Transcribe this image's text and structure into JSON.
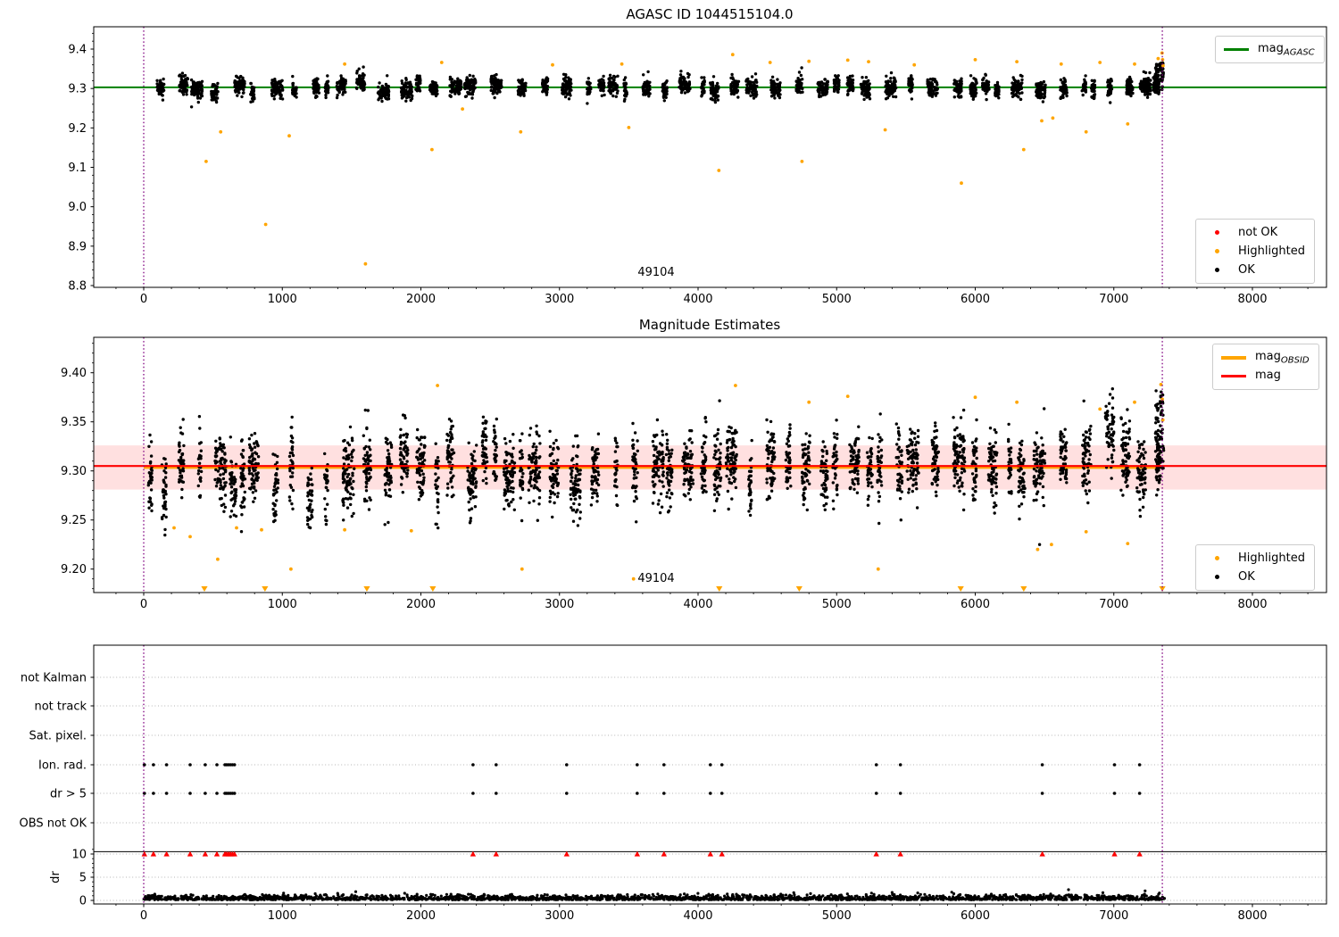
{
  "figure": {
    "background": "#ffffff"
  },
  "colors": {
    "mag_agasc_line": "#008000",
    "mag_line": "#ff0000",
    "mag_obsid_line": "#ffa500",
    "highlighted": "#ffa500",
    "not_ok": "#ff0000",
    "ok": "#000000",
    "obsid_boundary": "#800080",
    "mag_err_band": "rgba(255,0,0,0.12)",
    "grid_dotted": "#b5b5b5"
  },
  "legends": {
    "top_line": {
      "items": [
        {
          "label_main": "mag",
          "label_sub": "AGASC",
          "color": "#008000",
          "type": "line"
        }
      ]
    },
    "top_markers": {
      "items": [
        {
          "label": "not OK",
          "color": "#ff0000"
        },
        {
          "label": "Highlighted",
          "color": "#ffa500"
        },
        {
          "label": "OK",
          "color": "#000000"
        }
      ]
    },
    "mid_lines": {
      "items": [
        {
          "label_main": "mag",
          "label_sub": "OBSID",
          "color": "#ffa500",
          "type": "line-thick"
        },
        {
          "label_main": "mag",
          "label_sub": "",
          "color": "#ff0000",
          "type": "line"
        }
      ]
    },
    "mid_markers": {
      "items": [
        {
          "label": "Highlighted",
          "color": "#ffa500"
        },
        {
          "label": "OK",
          "color": "#000000"
        }
      ]
    }
  },
  "chart_data": [
    {
      "type": "scatter",
      "title": "AGASC ID 1044515104.0",
      "xlim": [
        -361,
        8534
      ],
      "ylim": [
        8.795,
        9.457
      ],
      "xticks": [
        0,
        1000,
        2000,
        3000,
        4000,
        5000,
        6000,
        7000,
        8000
      ],
      "xtick_labels": [
        "0",
        "1000",
        "2000",
        "3000",
        "4000",
        "5000",
        "6000",
        "7000",
        "8000"
      ],
      "yticks": [
        8.8,
        8.9,
        9.0,
        9.1,
        9.2,
        9.3,
        9.4
      ],
      "ytick_labels": [
        "8.8",
        "8.9",
        "9.0",
        "9.1",
        "9.2",
        "9.3",
        "9.4"
      ],
      "mag_agasc": 9.303,
      "obsid_boundaries_x": [
        0,
        7350
      ],
      "annotation": {
        "text": "49104",
        "x": 3697,
        "y": 8.825
      },
      "ok_points_model": {
        "seed": 42,
        "x_start": 15,
        "x_end": 7290,
        "gap_min": 18,
        "gap_rand": 105,
        "w_min": 22,
        "w_rand": 62,
        "density": 0.85,
        "pts_base": 8,
        "cluster_sigma": 0.0068,
        "point_sigma": 0.0115,
        "base_mag": 9.302,
        "trend_x0": 6300,
        "trend_mag": 0.011,
        "tail_prob": 0.06,
        "tail_mag": 0.022,
        "clamp": [
          9.245,
          9.405
        ],
        "final_cluster": {
          "x0": 7300,
          "x1": 7358,
          "n": 70,
          "y0": 9.295,
          "y1": 9.365
        }
      },
      "highlighted_points": [
        [
          450,
          9.115
        ],
        [
          555,
          9.19
        ],
        [
          880,
          8.955
        ],
        [
          1050,
          9.18
        ],
        [
          1600,
          8.855
        ],
        [
          2080,
          9.145
        ],
        [
          2300,
          9.248
        ],
        [
          2720,
          9.19
        ],
        [
          3500,
          9.201
        ],
        [
          4150,
          9.092
        ],
        [
          4750,
          9.115
        ],
        [
          5350,
          9.195
        ],
        [
          5900,
          9.06
        ],
        [
          6350,
          9.145
        ],
        [
          6480,
          9.218
        ],
        [
          6560,
          9.225
        ],
        [
          6800,
          9.19
        ],
        [
          7100,
          9.21
        ],
        [
          1450,
          9.362
        ],
        [
          2150,
          9.366
        ],
        [
          2950,
          9.36
        ],
        [
          3450,
          9.362
        ],
        [
          4250,
          9.386
        ],
        [
          4520,
          9.366
        ],
        [
          4800,
          9.369
        ],
        [
          5080,
          9.372
        ],
        [
          5230,
          9.368
        ],
        [
          5560,
          9.36
        ],
        [
          6000,
          9.373
        ],
        [
          6300,
          9.368
        ],
        [
          6620,
          9.362
        ],
        [
          6900,
          9.366
        ],
        [
          7150,
          9.362
        ],
        [
          7320,
          9.376
        ],
        [
          7348,
          9.39
        ],
        [
          7352,
          9.373
        ],
        [
          7355,
          9.358
        ]
      ],
      "not_ok_points": []
    },
    {
      "type": "scatter",
      "title": "Magnitude Estimates",
      "xlim": [
        -361,
        8534
      ],
      "ylim": [
        9.176,
        9.436
      ],
      "xticks": [
        0,
        1000,
        2000,
        3000,
        4000,
        5000,
        6000,
        7000,
        8000
      ],
      "xtick_labels": [
        "0",
        "1000",
        "2000",
        "3000",
        "4000",
        "5000",
        "6000",
        "7000",
        "8000"
      ],
      "yticks": [
        9.2,
        9.25,
        9.3,
        9.35,
        9.4
      ],
      "ytick_labels": [
        "9.20",
        "9.25",
        "9.30",
        "9.35",
        "9.40"
      ],
      "mag": 9.305,
      "mag_obsid": 9.3035,
      "mag_err_band": [
        9.281,
        9.326
      ],
      "obsid_boundaries_x": [
        0,
        7350
      ],
      "annotation": {
        "text": "49104",
        "x": 3697,
        "y": 9.187
      },
      "ok_points_model": {
        "seed": 7,
        "x_start": 15,
        "x_end": 7290,
        "gap_min": 18,
        "gap_rand": 100,
        "w_min": 22,
        "w_rand": 62,
        "density": 0.9,
        "pts_base": 8,
        "cluster_sigma": 0.0105,
        "point_sigma": 0.0175,
        "base_mag": 9.2955,
        "trend_full": 0.023,
        "tail_prob": 0.09,
        "tail_mag": 0.035,
        "tail_left": true,
        "clamp": [
          9.225,
          9.4
        ],
        "final_cluster": {
          "x0": 7300,
          "x1": 7360,
          "n": 85,
          "y0": 9.3,
          "y1": 9.382
        }
      },
      "highlighted_points": [
        [
          219,
          9.242
        ],
        [
          335,
          9.233
        ],
        [
          534,
          9.21
        ],
        [
          670,
          9.242
        ],
        [
          850,
          9.24
        ],
        [
          1062,
          9.2
        ],
        [
          1450,
          9.24
        ],
        [
          1931,
          9.239
        ],
        [
          2730,
          9.2
        ],
        [
          3534,
          9.19
        ],
        [
          5300,
          9.2
        ],
        [
          6450,
          9.22
        ],
        [
          6550,
          9.225
        ],
        [
          6800,
          9.238
        ],
        [
          7100,
          9.226
        ],
        [
          2120,
          9.387
        ],
        [
          4270,
          9.387
        ],
        [
          4800,
          9.37
        ],
        [
          5080,
          9.376
        ],
        [
          6000,
          9.375
        ],
        [
          6300,
          9.37
        ],
        [
          6900,
          9.363
        ],
        [
          7150,
          9.37
        ],
        [
          7340,
          9.388
        ],
        [
          7350,
          9.373
        ],
        [
          7354,
          9.352
        ]
      ],
      "highlighted_clipped_x": [
        438,
        875,
        1610,
        2086,
        4153,
        4730,
        5895,
        6350,
        7350
      ]
    },
    {
      "type": "scatter",
      "title": "",
      "xlim": [
        -361,
        8534
      ],
      "xticks": [
        0,
        1000,
        2000,
        3000,
        4000,
        5000,
        6000,
        7000,
        8000
      ],
      "xtick_labels": [
        "0",
        "1000",
        "2000",
        "3000",
        "4000",
        "5000",
        "6000",
        "7000",
        "8000"
      ],
      "rows": [
        "not Kalman",
        "not track",
        "Sat. pixel.",
        "Ion. rad.",
        "dr > 5",
        "OBS not OK"
      ],
      "row_flags": {
        "Ion. rad.": [
          5,
          70,
          165,
          335,
          444,
          528,
          586,
          598,
          612,
          626,
          640,
          655,
          2376,
          2543,
          3052,
          3561,
          3754,
          4089,
          4172,
          5286,
          5460,
          6484,
          7005,
          7186
        ],
        "dr > 5": [
          5,
          70,
          165,
          335,
          444,
          528,
          586,
          598,
          612,
          626,
          640,
          655,
          2376,
          2543,
          3052,
          3561,
          3754,
          4089,
          4172,
          5286,
          5460,
          6484,
          7005,
          7186
        ]
      },
      "dr_axis": {
        "label": "dr",
        "ticks": [
          0,
          5,
          10
        ],
        "tick_labels": [
          "0",
          "5",
          "10"
        ]
      },
      "dr_clipped_big": {
        "value": 10,
        "x": [
          5,
          70,
          165,
          335,
          444,
          528,
          586,
          598,
          612,
          626,
          640,
          655,
          2376,
          2543,
          3052,
          3561,
          3754,
          4089,
          4172,
          5286,
          5460,
          6484,
          7005,
          7186
        ]
      },
      "dr_hline": 10.5,
      "obsid_boundaries_x": [
        0,
        7350
      ],
      "dr_points_model": {
        "seed": 99,
        "n": 2300,
        "x_max": 7370,
        "y_base": 0.12,
        "sigma": 0.5,
        "y_max": 2.3
      }
    }
  ]
}
